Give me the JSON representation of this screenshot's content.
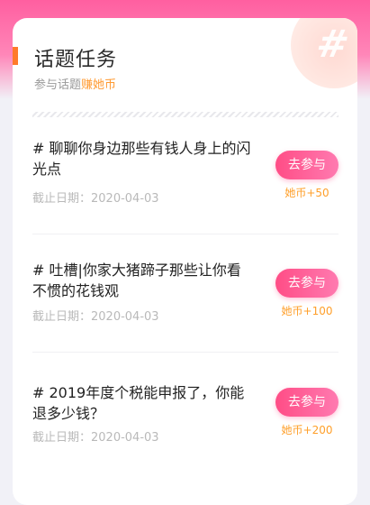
{
  "header": {
    "title": "话题任务",
    "subtitle_prefix": "参与话题",
    "subtitle_highlight": "赚她币"
  },
  "tasks": [
    {
      "title": "# 聊聊你身边那些有钱人身上的闪光点",
      "deadline": "截止日期：2020-04-03",
      "button_label": "去参与",
      "reward": "她币+50"
    },
    {
      "title": "# 吐槽|你家大猪蹄子那些让你看不惯的花钱观",
      "deadline": "截止日期：2020-04-03",
      "button_label": "去参与",
      "reward": "她币+100"
    },
    {
      "title": "# 2019年度个税能申报了，你能退多少钱？",
      "deadline": "截止日期：2020-04-03",
      "button_label": "去参与",
      "reward": "她币+200"
    }
  ],
  "colors": {
    "accent_pink": "#ff4d86",
    "accent_orange": "#ff9b33"
  }
}
